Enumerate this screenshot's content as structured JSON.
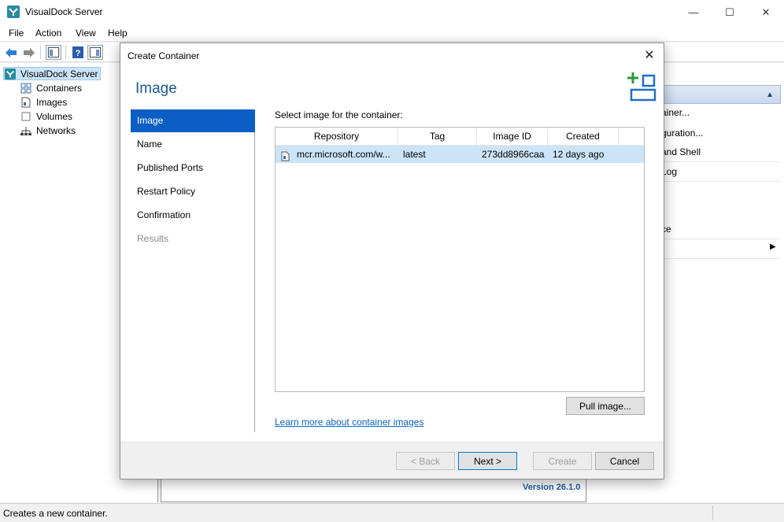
{
  "window": {
    "title": "VisualDock Server",
    "controls": {
      "minimize": "—",
      "maximize": "☐",
      "close": "✕"
    }
  },
  "menu": [
    "File",
    "Action",
    "View",
    "Help"
  ],
  "tree": {
    "root": "VisualDock Server",
    "items": [
      "Containers",
      "Images",
      "Volumes",
      "Networks"
    ]
  },
  "center": {
    "version": "Version 26.1.0"
  },
  "right_panel": {
    "header_arrow": "▲",
    "header_text": "r",
    "actions": [
      "ainer...",
      "guration...",
      "and Shell",
      "Log",
      "ce"
    ],
    "submenu_arrow": "▶"
  },
  "status": {
    "text": "Creates a new container."
  },
  "dialog": {
    "title": "Create Container",
    "close": "✕",
    "heading": "Image",
    "steps": [
      {
        "label": "Image",
        "state": "active"
      },
      {
        "label": "Name",
        "state": "normal"
      },
      {
        "label": "Published Ports",
        "state": "normal"
      },
      {
        "label": "Restart Policy",
        "state": "normal"
      },
      {
        "label": "Confirmation",
        "state": "normal"
      },
      {
        "label": "Results",
        "state": "disabled"
      }
    ],
    "select_label": "Select image for the container:",
    "columns": [
      "Repository",
      "Tag",
      "Image ID",
      "Created"
    ],
    "rows": [
      {
        "repository": "mcr.microsoft.com/w...",
        "tag": "latest",
        "image_id": "273dd8966caa",
        "created": "12 days ago"
      }
    ],
    "pull_button": "Pull image...",
    "learn_link": "Learn more about container images",
    "buttons": {
      "back": "< Back",
      "next": "Next >",
      "create": "Create",
      "cancel": "Cancel"
    }
  },
  "colors": {
    "accent": "#0a5ec4",
    "heading": "#1a5a96",
    "selection": "#cce4f7",
    "add_icon": "#2a9d3c"
  }
}
